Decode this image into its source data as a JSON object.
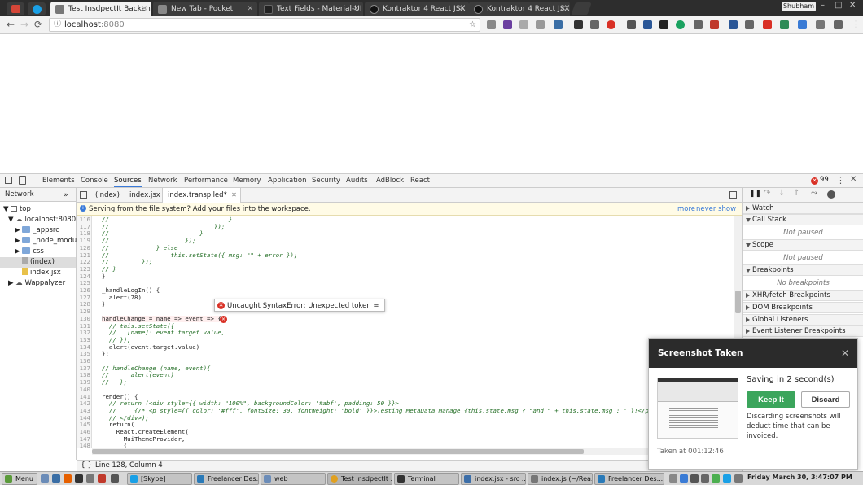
{
  "browser": {
    "tabs": [
      {
        "title": "",
        "color": "#d44638"
      },
      {
        "title": "",
        "color": "#1aa0e6"
      },
      {
        "title": "Test InsdpectIt Backend",
        "active": true,
        "color": "#555555"
      },
      {
        "title": "New Tab - Pocket",
        "color": "#888888"
      },
      {
        "title": "Text Fields - Material-UI",
        "color": "#222222"
      },
      {
        "title": "Kontraktor 4 React JSX",
        "color": "#333333"
      },
      {
        "title": "Kontraktor 4 React JSX",
        "color": "#333333"
      }
    ],
    "profile_name": "Shubham",
    "url_host": "localhost",
    "url_port": ":8080"
  },
  "devtools": {
    "tabs": [
      "Elements",
      "Console",
      "Sources",
      "Network",
      "Performance",
      "Memory",
      "Application",
      "Security",
      "Audits",
      "AdBlock",
      "React"
    ],
    "active_tab": "Sources",
    "error_count": "99",
    "navigator": {
      "header": "Network",
      "items": [
        {
          "label": "top",
          "depth": 0,
          "kind": "frame"
        },
        {
          "label": "localhost:8080",
          "depth": 1,
          "kind": "cloud"
        },
        {
          "label": "_appsrc",
          "depth": 2,
          "kind": "folder"
        },
        {
          "label": "_node_modules",
          "depth": 2,
          "kind": "folder"
        },
        {
          "label": "css",
          "depth": 2,
          "kind": "folder"
        },
        {
          "label": "(index)",
          "depth": 2,
          "kind": "file-grey",
          "selected": true
        },
        {
          "label": "index.jsx",
          "depth": 2,
          "kind": "file"
        },
        {
          "label": "Wappalyzer",
          "depth": 1,
          "kind": "cloud"
        }
      ]
    },
    "editor_tabs": [
      "(index)",
      "index.jsx",
      "index.transpiled*"
    ],
    "workspace_banner": "Serving from the file system? Add your files into the workspace.",
    "banner_more": "more",
    "banner_never_show": "never show",
    "error_popup": "Uncaught SyntaxError: Unexpected token =",
    "status_line": "Line 128, Column 4",
    "code": [
      {
        "n": "116",
        "t": "//                                 }",
        "c": true
      },
      {
        "n": "117",
        "t": "//                             });",
        "c": true
      },
      {
        "n": "118",
        "t": "//                         }",
        "c": true
      },
      {
        "n": "119",
        "t": "//                     });",
        "c": true
      },
      {
        "n": "120",
        "t": "//             } else",
        "c": true
      },
      {
        "n": "121",
        "t": "//                 this.setState({ msg: \"\" + error });",
        "c": true
      },
      {
        "n": "122",
        "t": "//         });",
        "c": true
      },
      {
        "n": "123",
        "t": "// }",
        "c": true
      },
      {
        "n": "124",
        "t": "}",
        "c": false
      },
      {
        "n": "125",
        "t": "",
        "c": false
      },
      {
        "n": "126",
        "t": "_handleLogIn() {",
        "c": false
      },
      {
        "n": "127",
        "t": "  alert(78)",
        "c": false
      },
      {
        "n": "128",
        "t": "}",
        "c": false
      },
      {
        "n": "129",
        "t": "",
        "c": false
      },
      {
        "n": "130",
        "t": "handleChange = name => event => {",
        "c": false,
        "err": true
      },
      {
        "n": "131",
        "t": "  // this.setState({",
        "c": true
      },
      {
        "n": "132",
        "t": "  //   [name]: event.target.value,",
        "c": true
      },
      {
        "n": "133",
        "t": "  // });",
        "c": true
      },
      {
        "n": "134",
        "t": "  alert(event.target.value)",
        "c": false
      },
      {
        "n": "135",
        "t": "};",
        "c": false
      },
      {
        "n": "136",
        "t": "",
        "c": false
      },
      {
        "n": "137",
        "t": "// handleChange (name, event){",
        "c": true
      },
      {
        "n": "138",
        "t": "//      alert(event)",
        "c": true
      },
      {
        "n": "139",
        "t": "//   };",
        "c": true
      },
      {
        "n": "140",
        "t": "",
        "c": false
      },
      {
        "n": "141",
        "t": "render() {",
        "c": false
      },
      {
        "n": "142",
        "t": "  // return (<div style={{ width: \"100%\", backgroundColor: '#abf', padding: 50 }}>",
        "c": true
      },
      {
        "n": "143",
        "t": "  //     {/* <p style={{ color: '#fff', fontSize: 30, fontWeight: 'bold' }}>Testing MetaData Manage {this.state.msg ? \"and \" + this.state.msg : ''}!</p>",
        "c": true
      },
      {
        "n": "144",
        "t": "  // </div>);",
        "c": true
      },
      {
        "n": "145",
        "t": "  return(",
        "c": false
      },
      {
        "n": "146",
        "t": "    React.createElement(",
        "c": false
      },
      {
        "n": "147",
        "t": "      MuiThemeProvider,",
        "c": false
      },
      {
        "n": "148",
        "t": "      {",
        "c": false
      },
      {
        "n": "149",
        "t": "",
        "c": false
      }
    ],
    "debugger": {
      "sections": [
        {
          "label": "Watch",
          "open": false
        },
        {
          "label": "Call Stack",
          "open": true,
          "body": "Not paused"
        },
        {
          "label": "Scope",
          "open": true,
          "body": "Not paused"
        },
        {
          "label": "Breakpoints",
          "open": true,
          "body": "No breakpoints"
        },
        {
          "label": "XHR/fetch Breakpoints",
          "open": false
        },
        {
          "label": "DOM Breakpoints",
          "open": false
        },
        {
          "label": "Global Listeners",
          "open": false
        },
        {
          "label": "Event Listener Breakpoints",
          "open": false
        }
      ]
    }
  },
  "toast": {
    "title": "Screenshot Taken",
    "saving": "Saving in 2 second(s)",
    "keep": "Keep It",
    "discard": "Discard",
    "note": "Discarding screenshots will deduct time that can be invoiced.",
    "taken_at": "Taken at 001:12:46"
  },
  "taskbar": {
    "menu": "Menu",
    "windows": [
      {
        "label": "[Skype]",
        "color": "#1aa0e6"
      },
      {
        "label": "Freelancer Des...",
        "color": "#2a7ab8"
      },
      {
        "label": "web",
        "color": "#6b8cb8"
      },
      {
        "label": "Test InsdpectIt ...",
        "color": "#e0a020"
      },
      {
        "label": "Terminal",
        "color": "#333333"
      },
      {
        "label": "index.jsx - src ...",
        "color": "#3c6ea8"
      },
      {
        "label": "index.js (~/Rea...",
        "color": "#777777"
      },
      {
        "label": "Freelancer Des...",
        "color": "#2a7ab8"
      }
    ],
    "clock": "Friday March 30,  3:47:07 PM"
  }
}
